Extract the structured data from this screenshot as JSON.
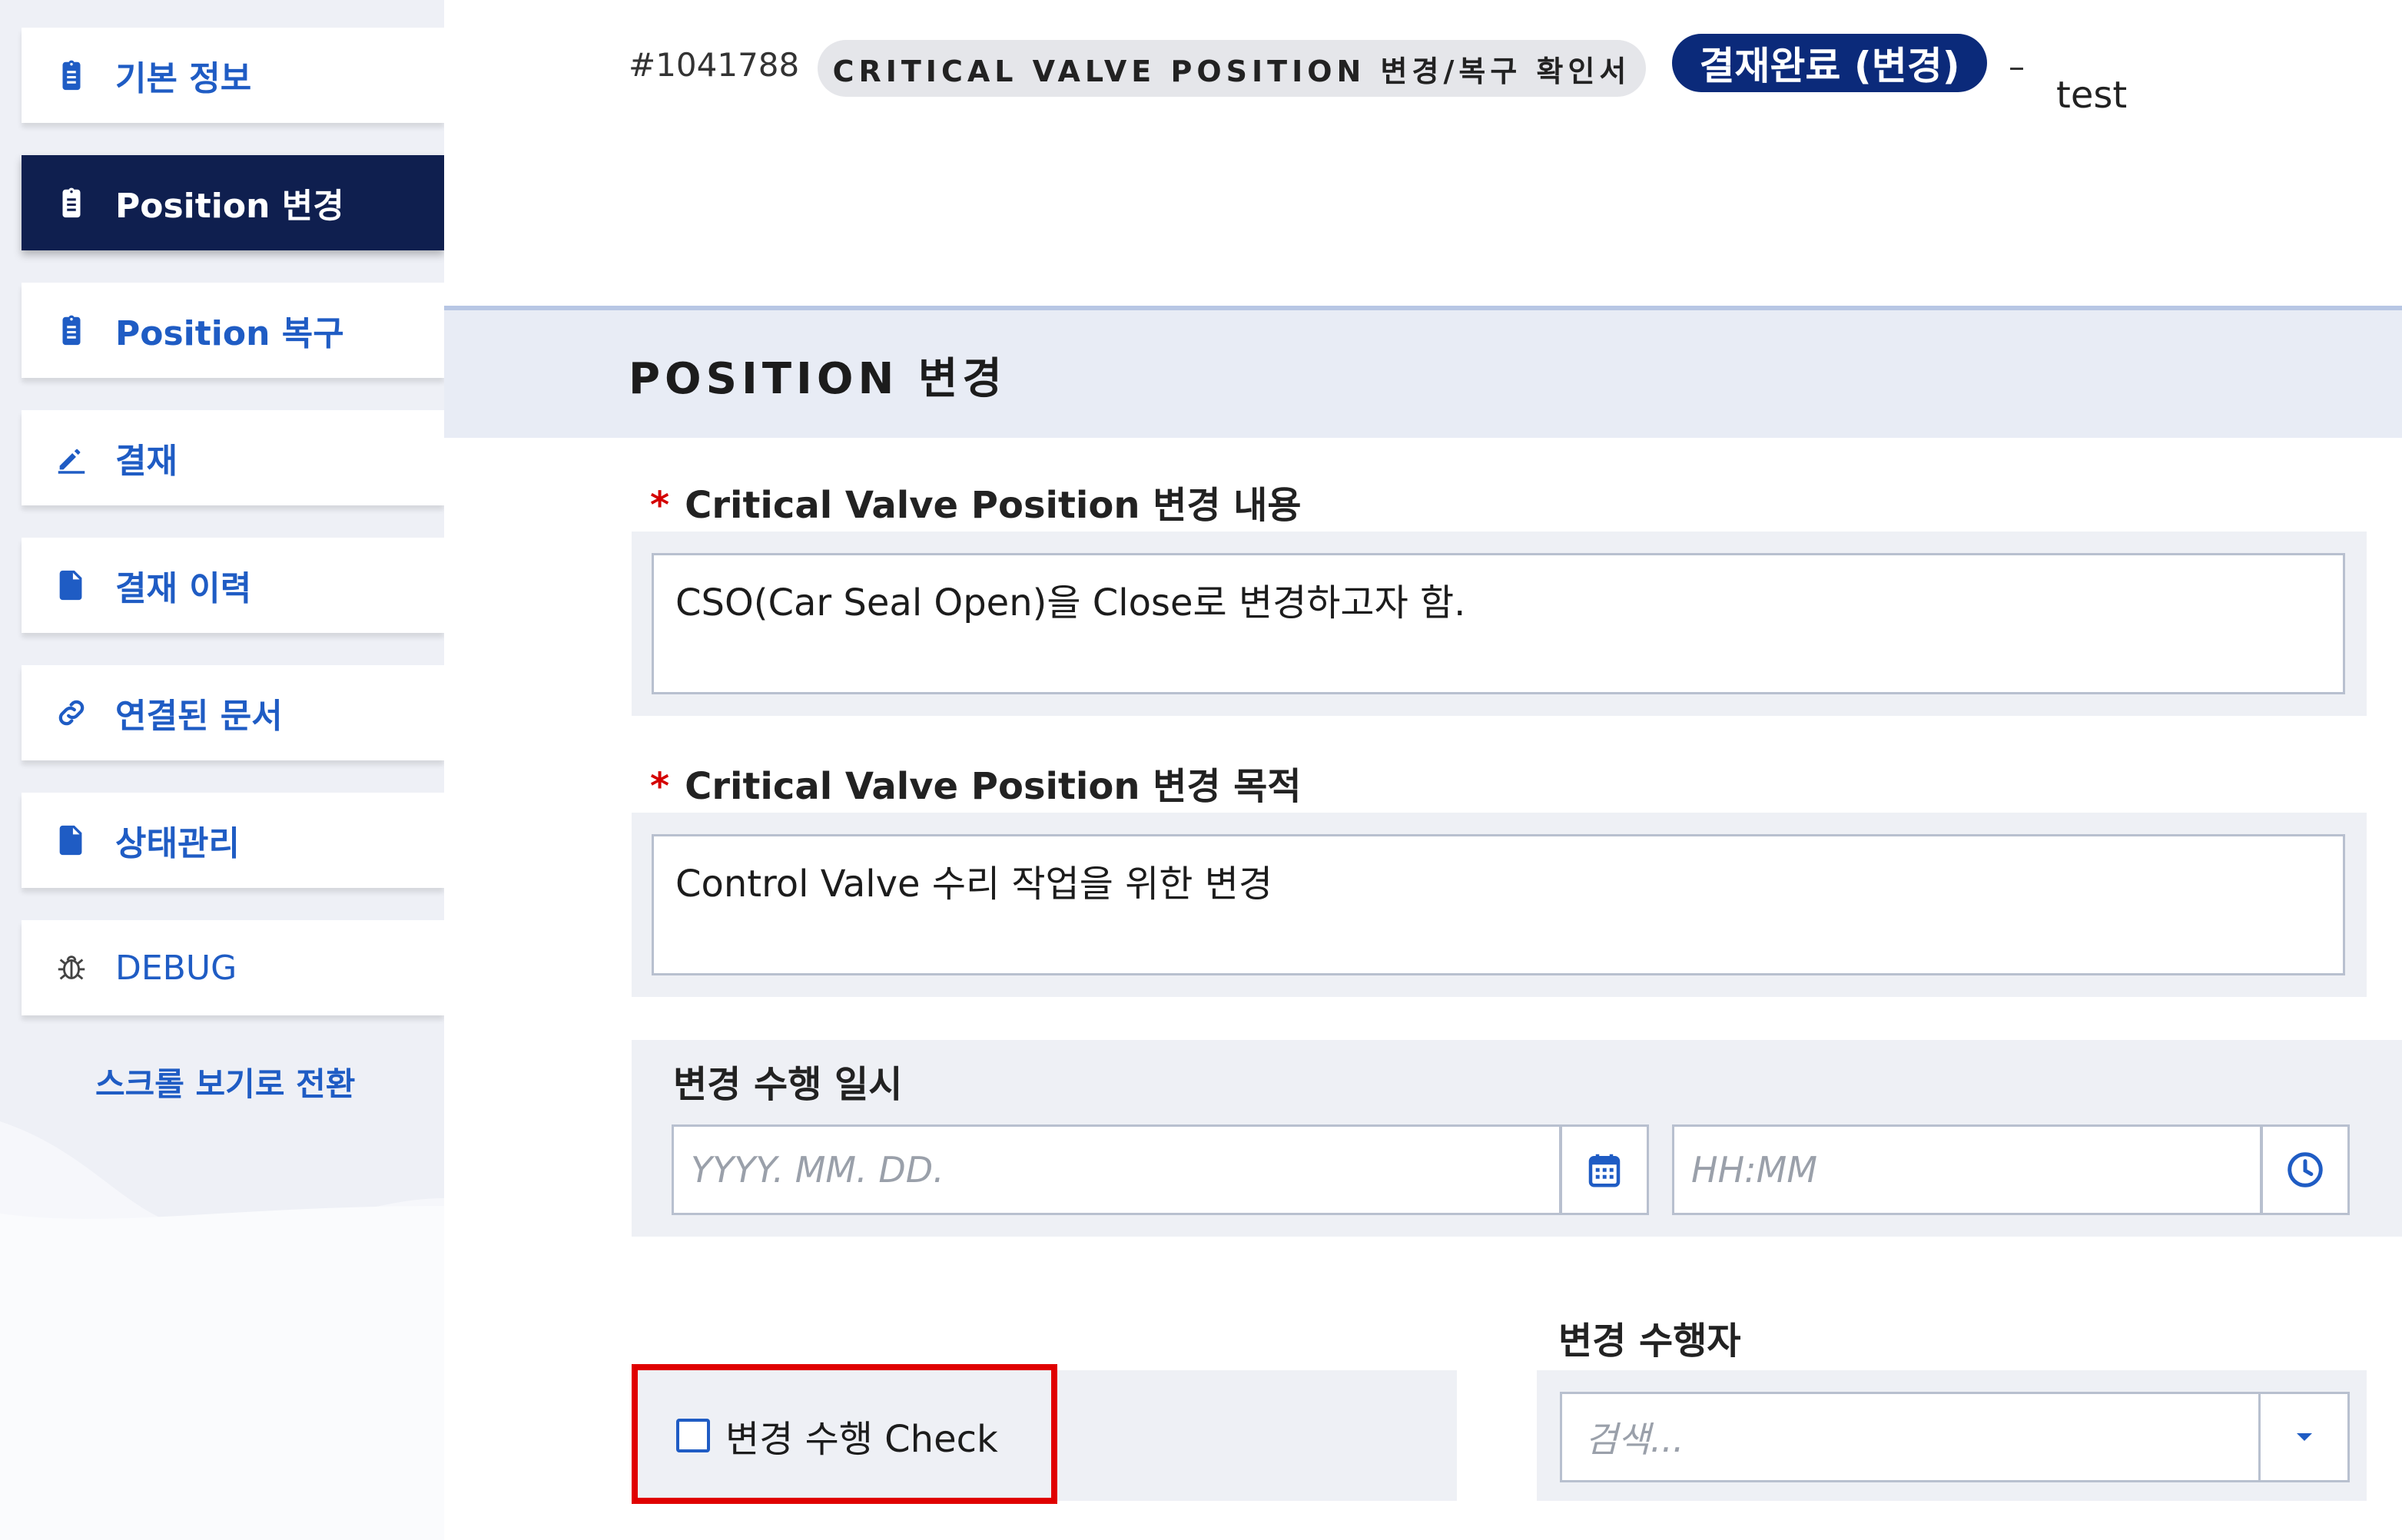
{
  "sidebar": {
    "items": [
      {
        "label": "기본 정보",
        "icon": "clipboard-icon"
      },
      {
        "label": "Position 변경",
        "icon": "clipboard-icon",
        "active": true
      },
      {
        "label": "Position 복구",
        "icon": "clipboard-icon"
      },
      {
        "label": "결재",
        "icon": "pen-icon"
      },
      {
        "label": "결재 이력",
        "icon": "file-icon"
      },
      {
        "label": "연결된 문서",
        "icon": "link-icon"
      },
      {
        "label": "상태관리",
        "icon": "file-icon"
      },
      {
        "label": "DEBUG",
        "icon": "bug-icon"
      }
    ],
    "scroll_toggle": "스크롤 보기로 전환"
  },
  "header": {
    "doc_no": "#1041788",
    "doc_type": "CRITICAL VALVE POSITION 변경/복구 확인서",
    "status": "결재완료 (변경)",
    "dash": "–",
    "title": "test"
  },
  "section": {
    "title": "POSITION 변경"
  },
  "form": {
    "change_content": {
      "required_mark": "*",
      "label": "Critical Valve Position 변경 내용",
      "value": "CSO(Car Seal Open)을 Close로 변경하고자 함."
    },
    "change_purpose": {
      "required_mark": "*",
      "label": "Critical Valve Position 변경 목적",
      "value": "Control Valve 수리 작업을 위한 변경"
    },
    "execution_datetime": {
      "label": "변경 수행 일시",
      "date_placeholder": "YYYY. MM. DD.",
      "time_placeholder": "HH:MM"
    },
    "execution_check": {
      "label": "변경 수행 Check",
      "checked": false
    },
    "executor": {
      "label": "변경 수행자",
      "placeholder": "검색..."
    }
  },
  "colors": {
    "accent": "#1f5cc4",
    "active_nav": "#0f1f4f",
    "badge": "#0b2a7a",
    "highlight": "#e00000",
    "required": "#d40000"
  }
}
